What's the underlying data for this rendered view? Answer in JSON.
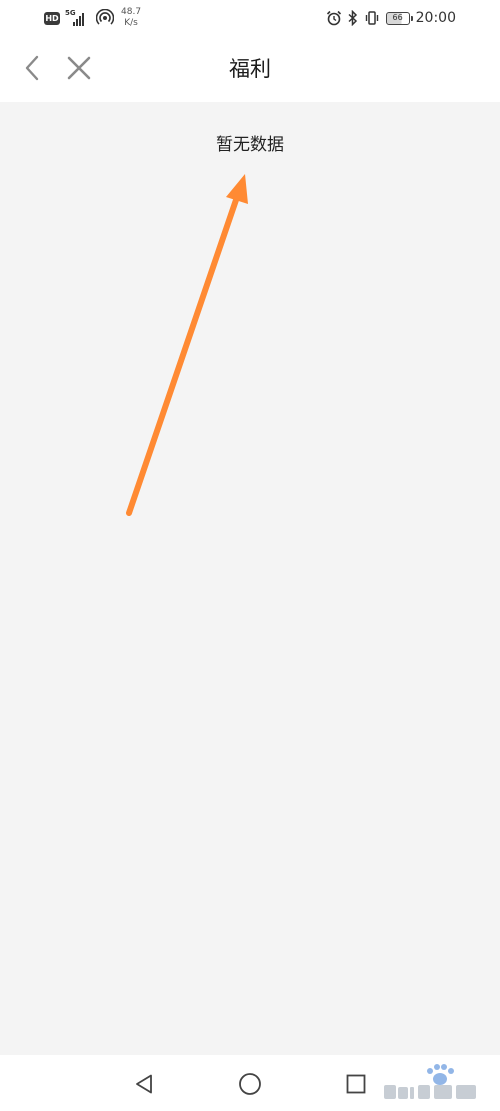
{
  "status_bar": {
    "hd": "HD",
    "network_type": "5G",
    "net_speed_value": "48.7",
    "net_speed_unit": "K/s",
    "battery_level": "66",
    "time": "20:00"
  },
  "header": {
    "title": "福利"
  },
  "content": {
    "empty_message": "暂无数据"
  },
  "annotation": {
    "arrow_color": "#ff8a33"
  },
  "icons": {
    "back": "back-arrow-icon",
    "close": "close-icon",
    "nav_back": "triangle-back-icon",
    "nav_home": "circle-home-icon",
    "nav_recent": "square-recent-icon"
  }
}
